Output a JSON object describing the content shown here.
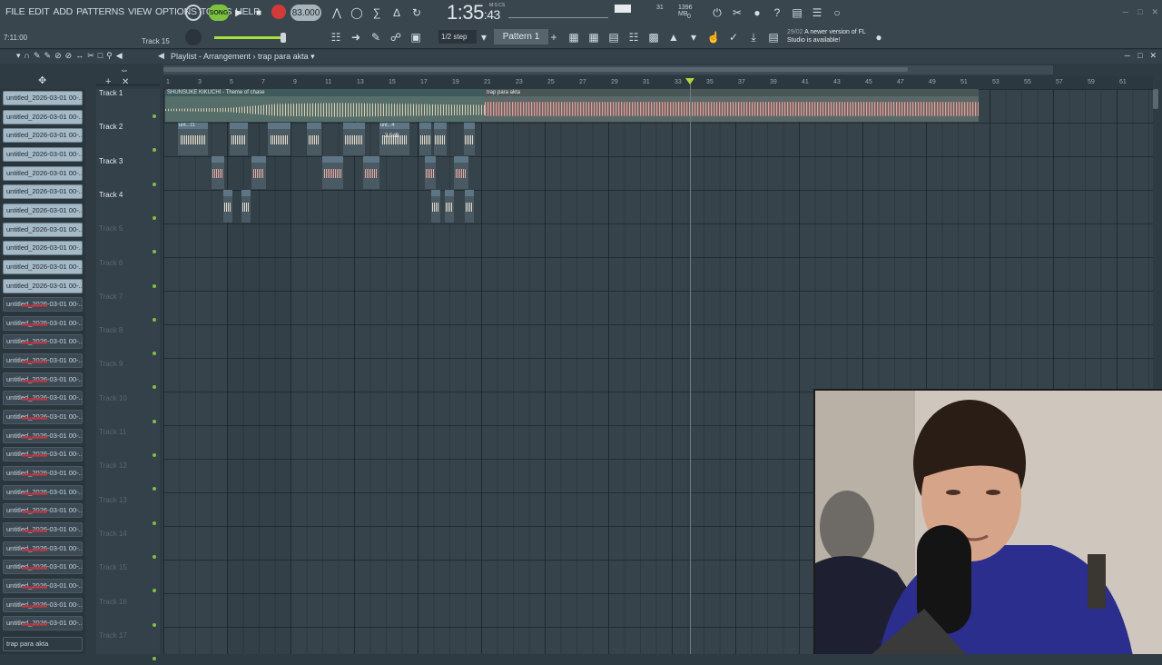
{
  "menu": [
    "FILE",
    "EDIT",
    "ADD",
    "PATTERNS",
    "VIEW",
    "OPTIONS",
    "TOOLS",
    "HELP"
  ],
  "hint_time": "7:11:00",
  "hint_track": "Track 15",
  "transport": {
    "song_label": "SONG",
    "tempo": "83.000",
    "time_main": "1:35",
    "time_small": ":43",
    "time_unit": "M:S:CS"
  },
  "monitor": {
    "cpu": "31",
    "memory": "1396 MB",
    "poly": "0"
  },
  "toolbar": {
    "snap": "1/2 step",
    "pattern": "Pattern 1"
  },
  "news": {
    "date": "29/02",
    "text": "A newer version of FL Studio is available!"
  },
  "playlist": {
    "title": "Playlist - Arrangement",
    "arrangement": "trap para akta"
  },
  "browser": {
    "items": [
      "untitled_2026-03-01 00-...",
      "untitled_2026-03-01 00-...",
      "untitled_2026-03-01 00-...",
      "untitled_2026-03-01 00-...",
      "untitled_2026-03-01 00-...",
      "untitled_2026-03-01 00-...",
      "untitled_2026-03-01 00-...",
      "untitled_2026-03-01 00-...",
      "untitled_2026-03-01 00-...",
      "untitled_2026-03-01 00-...",
      "untitled_2026-03-01 00-...",
      "untitled_2026-03-01 00-...",
      "untitled_2026-03-01 00-...",
      "untitled_2026-03-01 00-...",
      "untitled_2026-03-01 00-...",
      "untitled_2026-03-01 00-...",
      "untitled_2026-03-01 00-...",
      "untitled_2026-03-01 00-...",
      "untitled_2026-03-01 00-...",
      "untitled_2026-03-01 00-...",
      "untitled_2026-03-01 00-...",
      "untitled_2026-03-01 00-...",
      "untitled_2026-03-01 00-...",
      "untitled_2026-03-01 00-...",
      "untitled_2026-03-01 00-...",
      "untitled_2026-03-01 00-...",
      "untitled_2026-03-01 00-...",
      "untitled_2026-03-01 00-...",
      "untitled_2026-03-01 00-..."
    ],
    "selected": "trap para akta"
  },
  "tracks": [
    "Track 1",
    "Track 2",
    "Track 3",
    "Track 4",
    "Track 5",
    "Track 6",
    "Track 7",
    "Track 8",
    "Track 9",
    "Track 10",
    "Track 11",
    "Track 12",
    "Track 13",
    "Track 14",
    "Track 15",
    "Track 16",
    "Track 17"
  ],
  "ruler": [
    "1",
    "3",
    "5",
    "7",
    "9",
    "11",
    "13",
    "15",
    "17",
    "19",
    "21",
    "23",
    "25",
    "27",
    "29",
    "31",
    "33",
    "35",
    "37",
    "39",
    "41",
    "43",
    "45",
    "47",
    "49",
    "51",
    "53",
    "55",
    "57",
    "59",
    "61"
  ],
  "clips": {
    "track1_a": "SHUNSUKE KIKUCHI - Theme of chase",
    "track1_b": "trap para akta",
    "short_a": "unt...11",
    "short_b": "unt...4",
    "gain": "-3.5dB"
  }
}
